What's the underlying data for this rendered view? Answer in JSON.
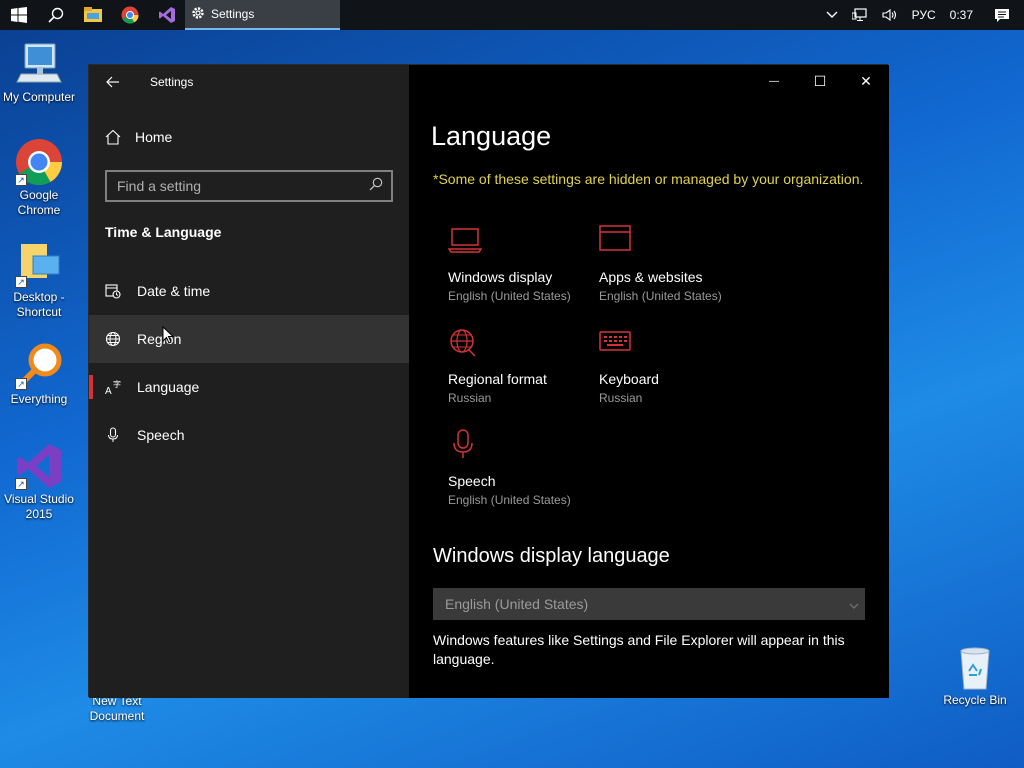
{
  "taskbar": {
    "app_label": "Settings",
    "lang": "РУС",
    "time": "0:37",
    "icons": [
      "windows-start-icon",
      "search-icon",
      "file-explorer-icon",
      "chrome-icon",
      "visual-studio-icon"
    ]
  },
  "desktop": {
    "icons": [
      {
        "label": "My Computer"
      },
      {
        "label": "Google Chrome"
      },
      {
        "label": "Desktop - Shortcut"
      },
      {
        "label": "Everything"
      },
      {
        "label": "Visual Studio 2015"
      },
      {
        "label": "New Text Document"
      },
      {
        "label": "Recycle Bin"
      }
    ]
  },
  "window": {
    "title": "Settings",
    "controls": {
      "minimize": "—",
      "maximize": "☐",
      "close": "✕"
    }
  },
  "sidebar": {
    "home": "Home",
    "search_placeholder": "Find a setting",
    "section": "Time & Language",
    "items": [
      {
        "label": "Date & time",
        "icon": "calendar-clock-icon"
      },
      {
        "label": "Region",
        "icon": "globe-icon"
      },
      {
        "label": "Language",
        "icon": "language-icon"
      },
      {
        "label": "Speech",
        "icon": "microphone-icon"
      }
    ]
  },
  "main": {
    "title": "Language",
    "org_note": "*Some of these settings are hidden or managed by your organization.",
    "tiles": [
      {
        "name": "Windows display",
        "sub": "English (United States)",
        "icon": "laptop-icon"
      },
      {
        "name": "Apps & websites",
        "sub": "English (United States)",
        "icon": "window-icon"
      },
      {
        "name": "Regional format",
        "sub": "Russian",
        "icon": "globe-icon"
      },
      {
        "name": "Keyboard",
        "sub": "Russian",
        "icon": "keyboard-icon"
      },
      {
        "name": "Speech",
        "sub": "English (United States)",
        "icon": "microphone-icon"
      }
    ],
    "display_lang_heading": "Windows display language",
    "display_lang_value": "English (United States)",
    "display_lang_desc": "Windows features like Settings and File Explorer will appear in this language."
  },
  "colors": {
    "accent": "#d13438",
    "org_note": "#e0d24c",
    "sidebar_bg": "#1f1f1f",
    "content_bg": "#000000"
  }
}
